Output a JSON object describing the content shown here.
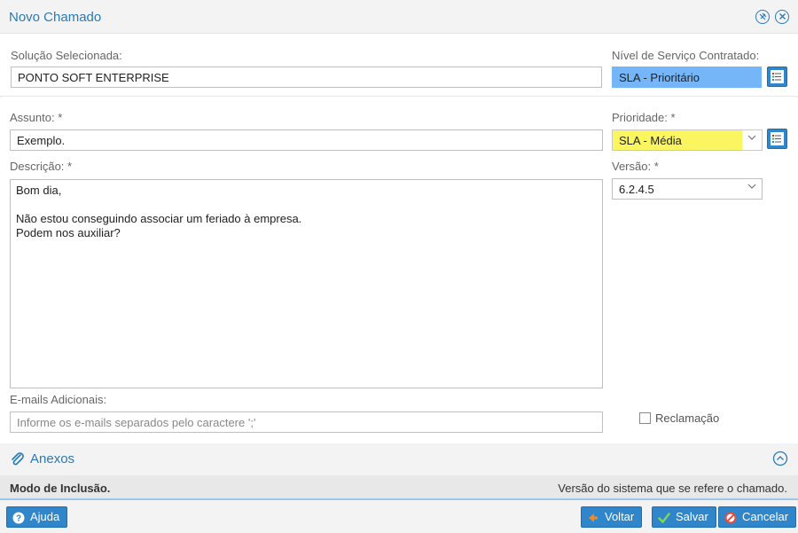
{
  "window": {
    "title": "Novo Chamado",
    "icons": [
      "pin-icon",
      "close-icon"
    ]
  },
  "solucao": {
    "label": "Solução Selecionada:",
    "value": "PONTO SOFT ENTERPRISE"
  },
  "nivel_servico": {
    "label": "Nível de Serviço Contratado:",
    "value": "SLA - Prioritário"
  },
  "assunto": {
    "label": "Assunto: *",
    "value": "Exemplo."
  },
  "prioridade": {
    "label": "Prioridade: *",
    "value": "SLA - Média"
  },
  "descricao": {
    "label": "Descrição: *",
    "lines": [
      "Bom dia,",
      "",
      "Não estou conseguindo associar um feriado à empresa.",
      "Podem nos auxiliar?"
    ]
  },
  "versao": {
    "label": "Versão: *",
    "value": "6.2.4.5"
  },
  "emails": {
    "label": "E-mails Adicionais:",
    "placeholder": "Informe os e-mails separados pelo caractere ';'"
  },
  "reclamacao": {
    "label": "Reclamação",
    "checked": false
  },
  "anexos": {
    "title": "Anexos"
  },
  "status": {
    "left": "Modo de Inclusão.",
    "right": "Versão do sistema que se refere o chamado."
  },
  "buttons": {
    "ajuda": "Ajuda",
    "voltar": "Voltar",
    "salvar": "Salvar",
    "cancelar": "Cancelar"
  },
  "colors": {
    "accent": "#2f86cb",
    "sla_prioritario_bg": "#74b6f7",
    "prioridade_bg": "#fbf660",
    "title_text": "#2a7ab8"
  }
}
